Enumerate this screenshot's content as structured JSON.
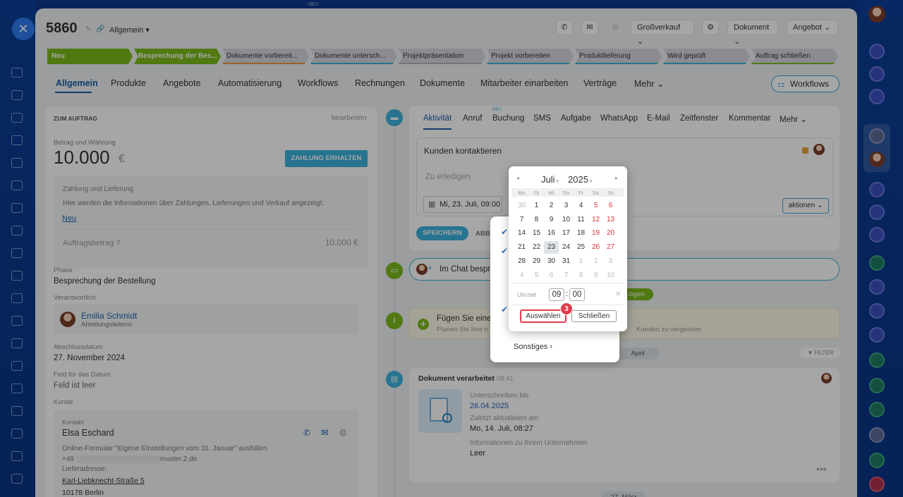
{
  "header": {
    "deal_id": "5860",
    "category": "Allgemein",
    "pipeline": "Großverkauf",
    "dokument": "Dokument",
    "angebot": "Angebot",
    "top_note": "NEU"
  },
  "stages": [
    "Neu",
    "Besprechung der Bes...",
    "Dokumente vorbereit...",
    "Dokumente untersch...",
    "Projektpräsentation",
    "Projekt vorbereiten",
    "Produktlieferung",
    "Wird geprüft",
    "Auftrag schließen"
  ],
  "tabs": [
    "Allgemein",
    "Produkte",
    "Angebote",
    "Automatisierung",
    "Workflows",
    "Rechnungen",
    "Dokumente",
    "Mitarbeiter einarbeiten",
    "Verträge",
    "Mehr"
  ],
  "workflows_btn": "Workflows",
  "left": {
    "section_title": "ZUM AUFTRAG",
    "edit": "bearbeiten",
    "amount_label": "Betrag und Währung",
    "amount": "10.000",
    "currency": "€",
    "pay_btn": "ZAHLUNG ERHALTEN",
    "pay_title": "Zahlung und Lieferung",
    "pay_desc": "Hier werden die Informationen über Zahlungen, Lieferungen und Verkauf angezeigt.",
    "pay_new": "Neu",
    "order_amount_label": "Auftragsbetrag",
    "order_amount": "10.000 €",
    "phase_label": "Phase",
    "phase": "Besprechung der Bestellung",
    "resp_label": "Verantwortlich",
    "resp_name": "Emilia Schmidt",
    "resp_role": "Abteilungsleiterin",
    "close_label": "Abschlussdatum",
    "close_date": "27. November 2024",
    "datefield_label": "Feld für das Datum",
    "datefield": "Feld ist leer",
    "customer_label": "Kunde",
    "contact_label": "Kontakt",
    "contact_name": "Elsa Eschard",
    "contact_source": "Online-Formular \"Eigene Einstellungen vom 31. Januar\" ausfüllen",
    "phone": "+49",
    "email": "muster.2.de",
    "addr_label": "Lieferadresse:",
    "street": "Karl-Liebknecht-Straße 5",
    "city": "10178 Berlin"
  },
  "activity_tabs": [
    "Aktivität",
    "Anruf",
    "Buchung",
    "SMS",
    "Aufgabe",
    "WhatsApp",
    "E-Mail",
    "Zeitfenster",
    "Kommentar",
    "Mehr"
  ],
  "activity_new": "NEU",
  "editor": {
    "title": "Kunden kontaktieren",
    "placeholder": "Zu erledigen",
    "date": "Mi, 23. Juli, 09:00",
    "actions": "aktionen",
    "save": "SPEICHERN",
    "cancel": "ABBR"
  },
  "chat": {
    "text": "Im Chat bespre"
  },
  "info": {
    "title": "Fügen Sie eine",
    "desc": "Planen Sie Ihre n",
    "desc2": "Kunden zu vergessen",
    "pill": "digen"
  },
  "timeline": {
    "april": "April",
    "filter": "FILTER",
    "march": "27. März"
  },
  "doc": {
    "title": "Dokument verarbeitet",
    "time": "08:41",
    "sign_label": "Unterschreiben bis",
    "sign_date": "26.04.2025",
    "updated_label": "Zuletzt aktualisiert am",
    "updated": "Mo, 14. Juli, 08:27",
    "company_label": "Informationen zu Ihrem Unternehmen",
    "company": "Leer"
  },
  "menu": {
    "other": "Sonstiges"
  },
  "calendar": {
    "month": "Juli",
    "year": "2025",
    "weekdays": [
      "Mo",
      "Di",
      "Mi",
      "Do",
      "Fr",
      "Sa",
      "So"
    ],
    "weeks": [
      [
        "30",
        "1",
        "2",
        "3",
        "4",
        "5",
        "6"
      ],
      [
        "7",
        "8",
        "9",
        "10",
        "11",
        "12",
        "13"
      ],
      [
        "14",
        "15",
        "16",
        "17",
        "18",
        "19",
        "20"
      ],
      [
        "21",
        "22",
        "23",
        "24",
        "25",
        "26",
        "27"
      ],
      [
        "28",
        "29",
        "30",
        "31",
        "1",
        "2",
        "3"
      ],
      [
        "4",
        "5",
        "6",
        "7",
        "8",
        "9",
        "10"
      ]
    ],
    "selected": "23",
    "time_label": "Uhrzeit",
    "hour": "09",
    "minute": "00",
    "select_btn": "Auswählen",
    "close_btn": "Schließen",
    "step_badge": "3"
  },
  "colors": {
    "accent": "#1a5ca8",
    "stage_done": "#7cbb1b",
    "primary_btn": "#3bb3dc",
    "highlight": "#e03c4a"
  }
}
